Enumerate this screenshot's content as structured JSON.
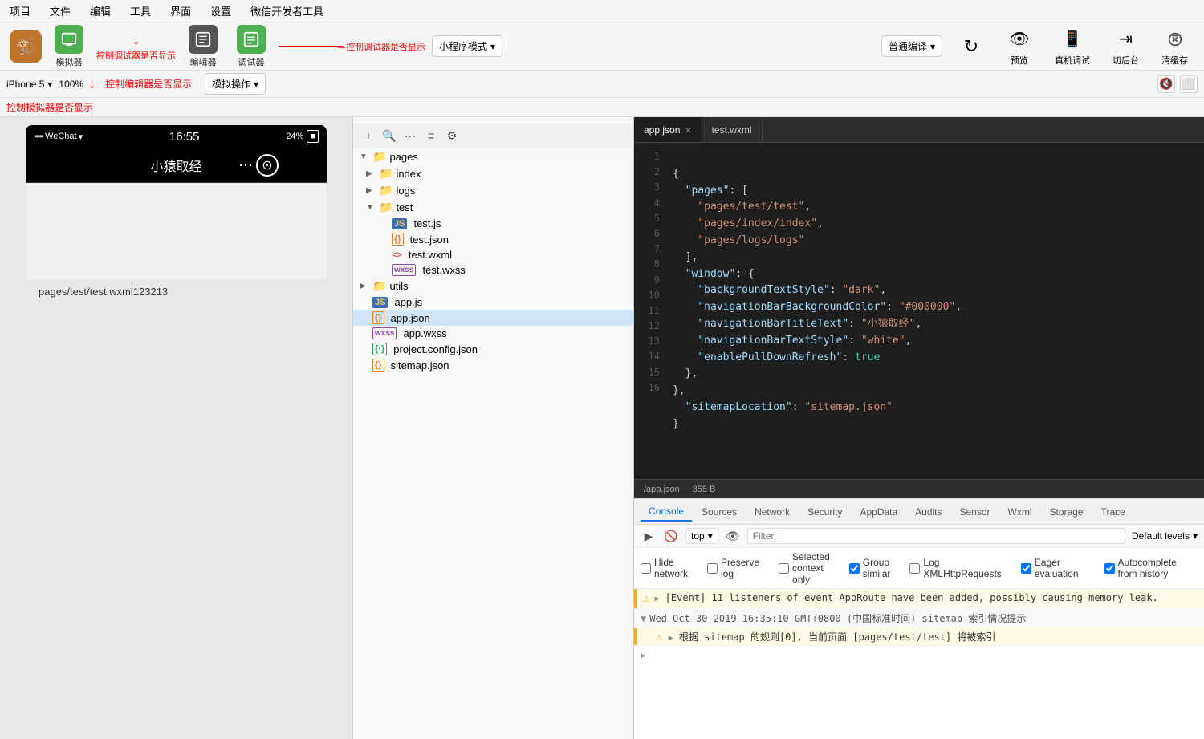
{
  "menubar": {
    "items": [
      "项目",
      "文件",
      "编辑",
      "工具",
      "界面",
      "设置",
      "微信开发者工具"
    ]
  },
  "toolbar": {
    "simulator_label": "模拟器",
    "editor_label": "编辑器",
    "debugger_label": "调试器",
    "simulator_annotation": "控制调试器是否显示",
    "app_mode_label": "小程序模式",
    "compile_label": "普通编译",
    "translate_label": "编译",
    "preview_label": "预览",
    "real_device_label": "真机调试",
    "cut_backend_label": "切后台",
    "clear_cache_label": "清缓存"
  },
  "device_bar": {
    "device": "iPhone 5",
    "zoom": "100%",
    "annotation": "控制编辑器是否显示",
    "simulate_ops_label": "模拟操作"
  },
  "annotation_bar": {
    "text": "控制模拟器是否显示"
  },
  "simulator": {
    "status_dots": "•••••",
    "wechat": "WeChat",
    "wifi": "▾",
    "time": "16:55",
    "battery_pct": "24%",
    "nav_title": "小猿取经",
    "nav_dots": "•••",
    "file_path": "pages/test/test.wxml123213"
  },
  "file_tree": {
    "items": [
      {
        "name": "pages",
        "type": "folder",
        "level": 0,
        "expanded": true,
        "arrow": "▼"
      },
      {
        "name": "index",
        "type": "folder",
        "level": 1,
        "expanded": false,
        "arrow": "▶"
      },
      {
        "name": "logs",
        "type": "folder",
        "level": 1,
        "expanded": false,
        "arrow": "▶"
      },
      {
        "name": "test",
        "type": "folder",
        "level": 1,
        "expanded": true,
        "arrow": "▼"
      },
      {
        "name": "test.js",
        "type": "js",
        "level": 2
      },
      {
        "name": "test.json",
        "type": "json",
        "level": 2
      },
      {
        "name": "test.wxml",
        "type": "wxml",
        "level": 2
      },
      {
        "name": "test.wxss",
        "type": "wxss",
        "level": 2
      },
      {
        "name": "utils",
        "type": "folder",
        "level": 0,
        "expanded": false,
        "arrow": "▶"
      },
      {
        "name": "app.js",
        "type": "js",
        "level": 0
      },
      {
        "name": "app.json",
        "type": "json",
        "level": 0,
        "selected": true
      },
      {
        "name": "app.wxss",
        "type": "wxss",
        "level": 0
      },
      {
        "name": "project.config.json",
        "type": "json",
        "level": 0
      },
      {
        "name": "sitemap.json",
        "type": "json",
        "level": 0
      }
    ]
  },
  "code_editor": {
    "tabs": [
      {
        "name": "app.json",
        "active": true
      },
      {
        "name": "test.wxml",
        "active": false
      }
    ],
    "lines": [
      {
        "num": 1,
        "code": "{"
      },
      {
        "num": 2,
        "code": "  \"pages\": ["
      },
      {
        "num": 3,
        "code": "    \"pages/test/test\","
      },
      {
        "num": 4,
        "code": "    \"pages/index/index\","
      },
      {
        "num": 5,
        "code": "    \"pages/logs/logs\""
      },
      {
        "num": 6,
        "code": "  ],"
      },
      {
        "num": 7,
        "code": "  \"window\": {"
      },
      {
        "num": 8,
        "code": "    \"backgroundTextStyle\": \"dark\","
      },
      {
        "num": 9,
        "code": "    \"navigationBarBackgroundColor\": \"#000000\","
      },
      {
        "num": 10,
        "code": "    \"navigationBarTitleText\": \"小猿取经\","
      },
      {
        "num": 11,
        "code": "    \"navigationBarTextStyle\": \"white\","
      },
      {
        "num": 12,
        "code": "    \"enablePullDownRefresh\": true"
      },
      {
        "num": 13,
        "code": "  },"
      },
      {
        "num": 14,
        "code": "},"
      },
      {
        "num": 15,
        "code": "  \"sitemapLocation\": \"sitemap.json\""
      },
      {
        "num": 16,
        "code": "}"
      }
    ],
    "footer_path": "/app.json",
    "footer_size": "355 B"
  },
  "debug": {
    "tabs": [
      "Console",
      "Sources",
      "Network",
      "Security",
      "AppData",
      "Audits",
      "Sensor",
      "Wxml",
      "Storage",
      "Trace"
    ],
    "active_tab": "Console",
    "toolbar": {
      "top_value": "top",
      "filter_placeholder": "Filter",
      "levels": "Default levels"
    },
    "options": {
      "hide_network": {
        "label": "Hide network",
        "checked": false
      },
      "preserve_log": {
        "label": "Preserve log",
        "checked": false
      },
      "selected_context": {
        "label": "Selected context only",
        "checked": false
      },
      "group_similar": {
        "label": "Group similar",
        "checked": true
      },
      "log_xml": {
        "label": "Log XMLHttpRequests",
        "checked": false
      },
      "eager_eval": {
        "label": "Eager evaluation",
        "checked": true
      },
      "autocomplete": {
        "label": "Autocomplete from history",
        "checked": true
      }
    },
    "console_items": [
      {
        "type": "warning",
        "text": "▶ [Event] 11 listeners of event AppRoute have been added, possibly causing memory leak.",
        "collapsed": true
      },
      {
        "type": "info-header",
        "text": "▼ Wed Oct 30 2019 16:35:10 GMT+0800 (中国标准时间) sitemap 索引情况提示",
        "expanded": true
      },
      {
        "type": "info-sub",
        "text": "⚠ ▶ 根据 sitemap 的规则[0], 当前页面 [pages/test/test] 将被索引"
      },
      {
        "type": "expand-arrow",
        "text": "▶"
      }
    ]
  }
}
